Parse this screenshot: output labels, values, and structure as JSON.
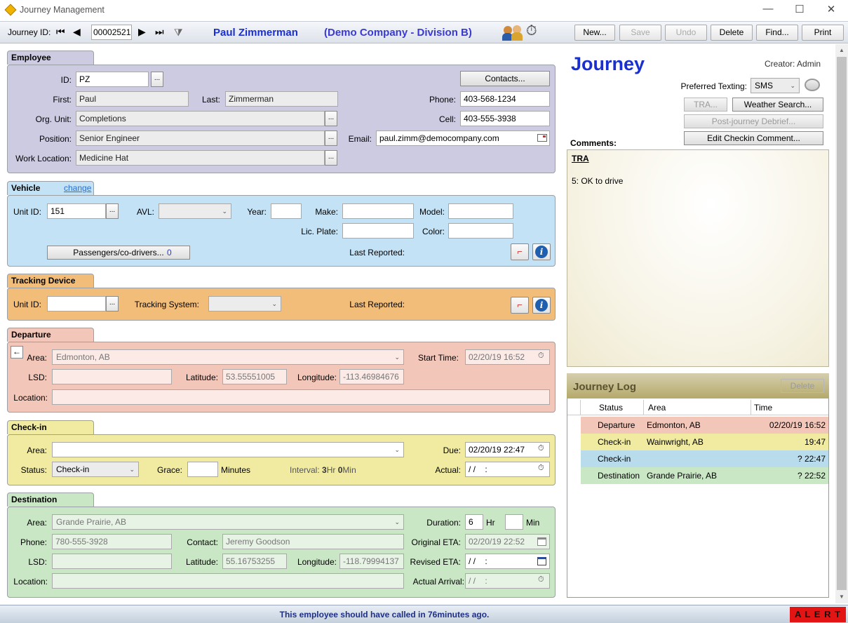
{
  "window": {
    "title": "Journey Management",
    "minimize": "—",
    "maximize": "☐",
    "close": "✕"
  },
  "toolbar": {
    "journey_id_label": "Journey ID:",
    "journey_id": "00002521",
    "employee_name": "Paul Zimmerman",
    "company": "(Demo Company - Division B)",
    "buttons": {
      "new": "New...",
      "save": "Save",
      "undo": "Undo",
      "delete": "Delete",
      "find": "Find...",
      "print": "Print"
    }
  },
  "employee": {
    "tab": "Employee",
    "id_label": "ID:",
    "id": "PZ",
    "first_label": "First:",
    "first": "Paul",
    "last_label": "Last:",
    "last": "Zimmerman",
    "org_label": "Org. Unit:",
    "org": "Completions",
    "position_label": "Position:",
    "position": "Senior Engineer",
    "work_label": "Work Location:",
    "work": "Medicine Hat",
    "contacts_btn": "Contacts...",
    "phone_label": "Phone:",
    "phone": "403-568-1234",
    "cell_label": "Cell:",
    "cell": "403-555-3938",
    "email_label": "Email:",
    "email": "paul.zimm@democompany.com"
  },
  "vehicle": {
    "tab": "Vehicle",
    "change_link": "change",
    "unit_label": "Unit ID:",
    "unit": "151",
    "avl_label": "AVL:",
    "year_label": "Year:",
    "make_label": "Make:",
    "model_label": "Model:",
    "plate_label": "Lic. Plate:",
    "color_label": "Color:",
    "passengers_btn": "Passengers/co-drivers...",
    "passengers_count": "0",
    "last_reported_label": "Last Reported:"
  },
  "tracking": {
    "tab": "Tracking Device",
    "unit_label": "Unit ID:",
    "system_label": "Tracking System:",
    "last_reported_label": "Last Reported:"
  },
  "departure": {
    "tab": "Departure",
    "area_label": "Area:",
    "area": "Edmonton, AB",
    "start_label": "Start Time:",
    "start": "02/20/19 16:52",
    "lsd_label": "LSD:",
    "lat_label": "Latitude:",
    "lat": "53.55551005",
    "lon_label": "Longitude:",
    "lon": "-113.46984676",
    "location_label": "Location:"
  },
  "checkin": {
    "tab": "Check-in",
    "area_label": "Area:",
    "due_label": "Due:",
    "due": "02/20/19 22:47",
    "status_label": "Status:",
    "status": "Check-in",
    "grace_label": "Grace:",
    "minutes_label": "Minutes",
    "interval_label": "Interval:",
    "interval_hr": "3",
    "hr_unit": "Hr",
    "interval_min": "0",
    "min_unit": "Min",
    "actual_label": "Actual:",
    "actual": "/ /    :"
  },
  "destination": {
    "tab": "Destination",
    "area_label": "Area:",
    "area": "Grande Prairie, AB",
    "duration_label": "Duration:",
    "duration_hr": "6",
    "hr_unit": "Hr",
    "min_unit": "Min",
    "phone_label": "Phone:",
    "phone": "780-555-3928",
    "contact_label": "Contact:",
    "contact": "Jeremy Goodson",
    "orig_eta_label": "Original ETA:",
    "orig_eta": "02/20/19 22:52",
    "lsd_label": "LSD:",
    "lat_label": "Latitude:",
    "lat": "55.16753255",
    "lon_label": "Longitude:",
    "lon": "-118.79994137",
    "rev_eta_label": "Revised ETA:",
    "rev_eta": "/ /    :",
    "location_label": "Location:",
    "actual_arrival_label": "Actual Arrival:",
    "actual_arrival": "/ /    :"
  },
  "journey": {
    "title": "Journey",
    "creator": "Creator: Admin",
    "preferred_label": "Preferred Texting:",
    "preferred": "SMS",
    "tra_btn": "TRA...",
    "weather_btn": "Weather Search...",
    "debrief_btn": "Post-journey Debrief...",
    "edit_btn": "Edit Checkin Comment...",
    "comments_label": "Comments:",
    "comment_heading": "TRA",
    "comment_text": "5: OK to drive"
  },
  "log": {
    "title": "Journey Log",
    "delete_btn": "Delete",
    "headers": {
      "status": "Status",
      "area": "Area",
      "time": "Time"
    },
    "rows": [
      {
        "status": "Departure",
        "area": "Edmonton, AB",
        "time": "02/20/19 16:52",
        "color": "#f2c6b9"
      },
      {
        "status": "Check-in",
        "area": "Wainwright, AB",
        "time": "19:47",
        "color": "#f0eba1"
      },
      {
        "status": "Check-in",
        "area": "",
        "time": "? 22:47",
        "color": "#b9dcec"
      },
      {
        "status": "Destination",
        "area": "Grande Prairie, AB",
        "time": "? 22:52",
        "color": "#c9e6c5"
      }
    ]
  },
  "status_bar": {
    "message": "This employee should have called in 76minutes ago.",
    "alert": "A L E R T"
  },
  "colors": {
    "employee": "#cccbe2",
    "vehicle": "#c3e2f5",
    "tracking": "#f2bd78",
    "departure": "#f2c6b9",
    "checkin": "#f0eba1",
    "destination": "#c9e6c5",
    "accent_blue": "#1a2fd0"
  }
}
